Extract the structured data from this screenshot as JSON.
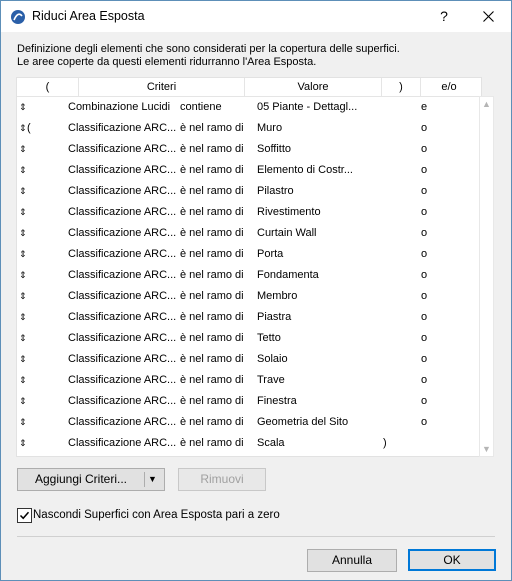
{
  "window": {
    "title": "Riduci Area Esposta",
    "help": "?"
  },
  "description": {
    "line1": "Definizione degli elementi che sono considerati per la copertura delle superfici.",
    "line2": "Le aree coperte da questi elementi ridurranno l'Area Esposta."
  },
  "table": {
    "headers": {
      "open_paren": "(",
      "criteria": "Criteri",
      "value": "Valore",
      "close_paren": ")",
      "andor": "e/o"
    },
    "rows": [
      {
        "handle": "⇕",
        "open": "",
        "criterion": "Combinazione Lucidi",
        "op": "contiene",
        "value": "05 Piante - Dettagl...",
        "close": "",
        "andor": "e"
      },
      {
        "handle": "⇕",
        "open": "(",
        "criterion": "Classificazione ARC...",
        "op": "è nel ramo di",
        "value": "Muro",
        "close": "",
        "andor": "o"
      },
      {
        "handle": "⇕",
        "open": "",
        "criterion": "Classificazione ARC...",
        "op": "è nel ramo di",
        "value": "Soffitto",
        "close": "",
        "andor": "o"
      },
      {
        "handle": "⇕",
        "open": "",
        "criterion": "Classificazione ARC...",
        "op": "è nel ramo di",
        "value": "Elemento di Costr...",
        "close": "",
        "andor": "o"
      },
      {
        "handle": "⇕",
        "open": "",
        "criterion": "Classificazione ARC...",
        "op": "è nel ramo di",
        "value": "Pilastro",
        "close": "",
        "andor": "o"
      },
      {
        "handle": "⇕",
        "open": "",
        "criterion": "Classificazione ARC...",
        "op": "è nel ramo di",
        "value": "Rivestimento",
        "close": "",
        "andor": "o"
      },
      {
        "handle": "⇕",
        "open": "",
        "criterion": "Classificazione ARC...",
        "op": "è nel ramo di",
        "value": "Curtain Wall",
        "close": "",
        "andor": "o"
      },
      {
        "handle": "⇕",
        "open": "",
        "criterion": "Classificazione ARC...",
        "op": "è nel ramo di",
        "value": "Porta",
        "close": "",
        "andor": "o"
      },
      {
        "handle": "⇕",
        "open": "",
        "criterion": "Classificazione ARC...",
        "op": "è nel ramo di",
        "value": "Fondamenta",
        "close": "",
        "andor": "o"
      },
      {
        "handle": "⇕",
        "open": "",
        "criterion": "Classificazione ARC...",
        "op": "è nel ramo di",
        "value": "Membro",
        "close": "",
        "andor": "o"
      },
      {
        "handle": "⇕",
        "open": "",
        "criterion": "Classificazione ARC...",
        "op": "è nel ramo di",
        "value": "Piastra",
        "close": "",
        "andor": "o"
      },
      {
        "handle": "⇕",
        "open": "",
        "criterion": "Classificazione ARC...",
        "op": "è nel ramo di",
        "value": "Tetto",
        "close": "",
        "andor": "o"
      },
      {
        "handle": "⇕",
        "open": "",
        "criterion": "Classificazione ARC...",
        "op": "è nel ramo di",
        "value": "Solaio",
        "close": "",
        "andor": "o"
      },
      {
        "handle": "⇕",
        "open": "",
        "criterion": "Classificazione ARC...",
        "op": "è nel ramo di",
        "value": "Trave",
        "close": "",
        "andor": "o"
      },
      {
        "handle": "⇕",
        "open": "",
        "criterion": "Classificazione ARC...",
        "op": "è nel ramo di",
        "value": "Finestra",
        "close": "",
        "andor": "o"
      },
      {
        "handle": "⇕",
        "open": "",
        "criterion": "Classificazione ARC...",
        "op": "è nel ramo di",
        "value": "Geometria del Sito",
        "close": "",
        "andor": "o"
      },
      {
        "handle": "⇕",
        "open": "",
        "criterion": "Classificazione ARC...",
        "op": "è nel ramo di",
        "value": "Scala",
        "close": ")",
        "andor": ""
      }
    ]
  },
  "buttons": {
    "add_criteria": "Aggiungi Criteri...",
    "remove": "Rimuovi",
    "cancel": "Annulla",
    "ok": "OK"
  },
  "checkbox": {
    "label": "Nascondi Superfici con Area Esposta pari a zero",
    "checked": true
  },
  "icons": {
    "app": "archicad-icon",
    "close": "close-icon",
    "dropdown": "chevron-down-icon",
    "drag": "drag-handle-icon"
  },
  "colors": {
    "accent": "#0078d7",
    "app_icon": "#2a5fa8"
  }
}
